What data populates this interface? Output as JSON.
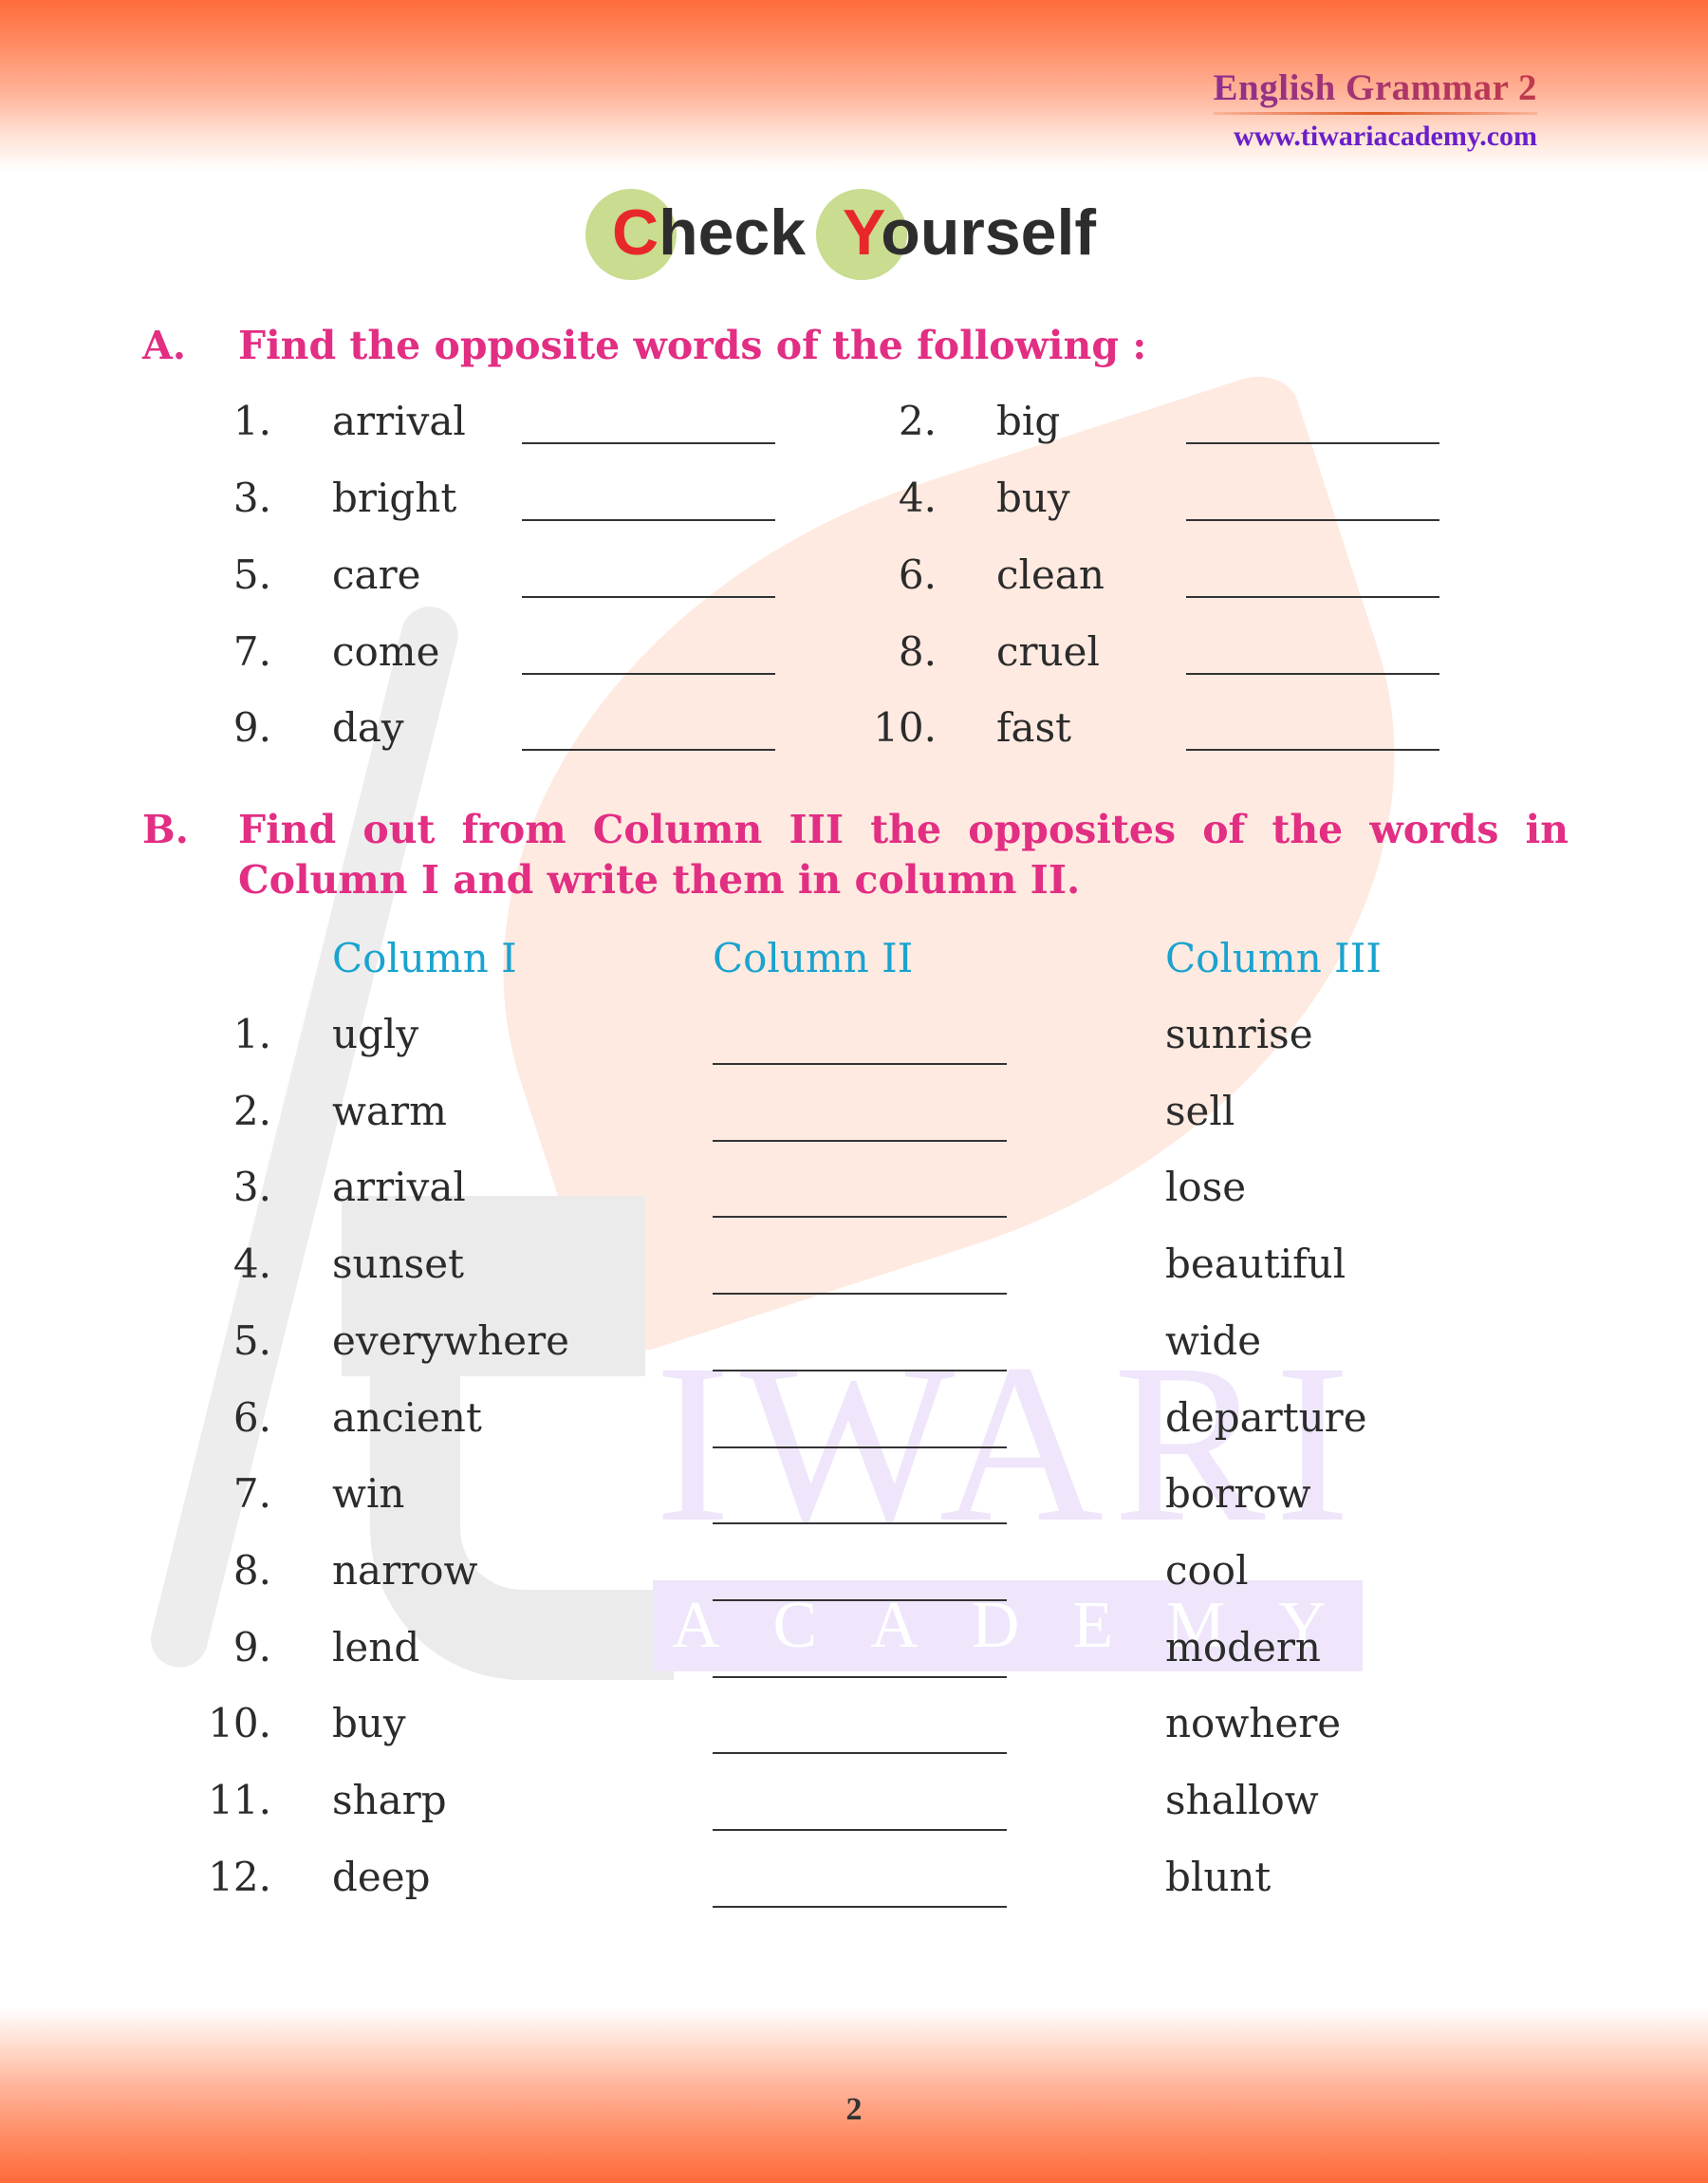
{
  "header": {
    "book_title": "English Grammar 2",
    "website": "www.tiwariacademy.com"
  },
  "watermark": {
    "line1": "IWARI",
    "line2": "ACADEMY"
  },
  "title": {
    "word1_initial": "C",
    "word1_rest": "heck",
    "word2_initial": "Y",
    "word2_rest": "ourself",
    "circle_color": "#c9dc8f",
    "initial_color": "#e8272a"
  },
  "section_a": {
    "letter": "A.",
    "instruction": "Find the opposite words of the following :",
    "items": [
      {
        "number": "1.",
        "word": "arrival",
        "blank": "___________"
      },
      {
        "number": "2.",
        "word": "big",
        "blank": "___________"
      },
      {
        "number": "3.",
        "word": "bright",
        "blank": "___________"
      },
      {
        "number": "4.",
        "word": "buy",
        "blank": "___________"
      },
      {
        "number": "5.",
        "word": "care",
        "blank": "___________"
      },
      {
        "number": "6.",
        "word": "clean",
        "blank": "___________"
      },
      {
        "number": "7.",
        "word": "come",
        "blank": "___________"
      },
      {
        "number": "8.",
        "word": "cruel",
        "blank": "___________"
      },
      {
        "number": "9.",
        "word": "day",
        "blank": "___________"
      },
      {
        "number": "10.",
        "word": "fast",
        "blank": "___________"
      }
    ]
  },
  "section_b": {
    "letter": "B.",
    "instruction_line1": "Find out from Column III the opposites of the words in",
    "instruction_line2": "Column I and write them in column II.",
    "column_headers": [
      "Column I",
      "Column II",
      "Column III"
    ],
    "rows": [
      {
        "number": "1.",
        "column_i": "ugly",
        "column_ii": "",
        "column_iii": "sunrise"
      },
      {
        "number": "2.",
        "column_i": "warm",
        "column_ii": "",
        "column_iii": "sell"
      },
      {
        "number": "3.",
        "column_i": "arrival",
        "column_ii": "",
        "column_iii": "lose"
      },
      {
        "number": "4.",
        "column_i": "sunset",
        "column_ii": "",
        "column_iii": "beautiful"
      },
      {
        "number": "5.",
        "column_i": "everywhere",
        "column_ii": "",
        "column_iii": "wide"
      },
      {
        "number": "6.",
        "column_i": "ancient",
        "column_ii": "",
        "column_iii": "departure"
      },
      {
        "number": "7.",
        "column_i": "win",
        "column_ii": "",
        "column_iii": "borrow"
      },
      {
        "number": "8.",
        "column_i": "narrow",
        "column_ii": "",
        "column_iii": "cool"
      },
      {
        "number": "9.",
        "column_i": "lend",
        "column_ii": "",
        "column_iii": "modern"
      },
      {
        "number": "10.",
        "column_i": "buy",
        "column_ii": "",
        "column_iii": "nowhere"
      },
      {
        "number": "11.",
        "column_i": "sharp",
        "column_ii": "",
        "column_iii": "shallow"
      },
      {
        "number": "12.",
        "column_i": "deep",
        "column_ii": "",
        "column_iii": "blunt"
      }
    ]
  },
  "footer": {
    "page_number": "2"
  },
  "colors": {
    "heading_pink": "#e22e83",
    "column_header_blue": "#1aa3cf",
    "band_orange": "#ff6b3a",
    "url_purple": "#6a1fc9"
  }
}
